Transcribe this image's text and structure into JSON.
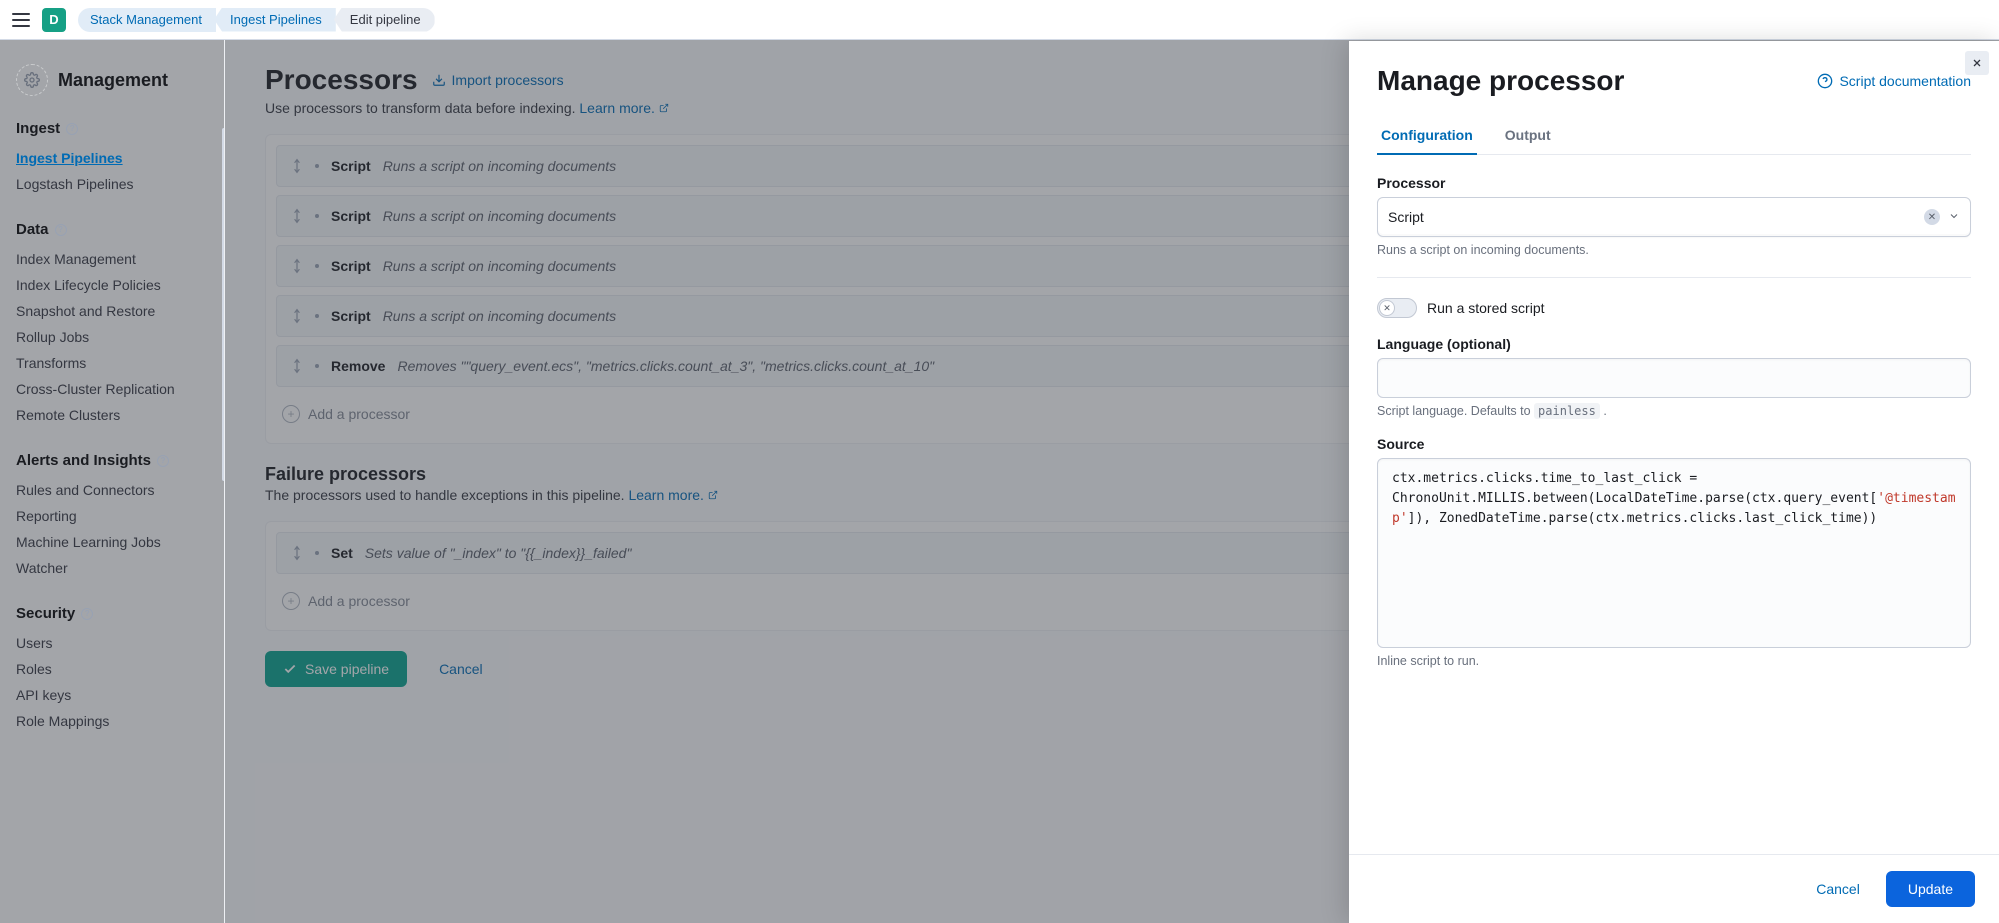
{
  "topbar": {
    "avatar_initial": "D",
    "breadcrumbs": [
      {
        "label": "Stack Management",
        "link": true
      },
      {
        "label": "Ingest Pipelines",
        "link": true
      },
      {
        "label": "Edit pipeline",
        "link": false
      }
    ]
  },
  "sidebar": {
    "title": "Management",
    "sections": [
      {
        "title": "Ingest",
        "help": true,
        "items": [
          {
            "label": "Ingest Pipelines",
            "active": true
          },
          {
            "label": "Logstash Pipelines"
          }
        ]
      },
      {
        "title": "Data",
        "help": true,
        "items": [
          {
            "label": "Index Management"
          },
          {
            "label": "Index Lifecycle Policies"
          },
          {
            "label": "Snapshot and Restore"
          },
          {
            "label": "Rollup Jobs"
          },
          {
            "label": "Transforms"
          },
          {
            "label": "Cross-Cluster Replication"
          },
          {
            "label": "Remote Clusters"
          }
        ]
      },
      {
        "title": "Alerts and Insights",
        "help": true,
        "items": [
          {
            "label": "Rules and Connectors"
          },
          {
            "label": "Reporting"
          },
          {
            "label": "Machine Learning Jobs"
          },
          {
            "label": "Watcher"
          }
        ]
      },
      {
        "title": "Security",
        "help": true,
        "items": [
          {
            "label": "Users"
          },
          {
            "label": "Roles"
          },
          {
            "label": "API keys"
          },
          {
            "label": "Role Mappings"
          }
        ]
      }
    ]
  },
  "main": {
    "processors_title": "Processors",
    "import_label": "Import processors",
    "subtext": "Use processors to transform data before indexing.",
    "learn_more": "Learn more.",
    "processors": [
      {
        "type": "Script",
        "desc": "Runs a script on incoming documents"
      },
      {
        "type": "Script",
        "desc": "Runs a script on incoming documents"
      },
      {
        "type": "Script",
        "desc": "Runs a script on incoming documents"
      },
      {
        "type": "Script",
        "desc": "Runs a script on incoming documents"
      },
      {
        "type": "Remove",
        "desc": "Removes \"\"query_event.ecs\", \"metrics.clicks.count_at_3\", \"metrics.clicks.count_at_10\""
      }
    ],
    "add_processor": "Add a processor",
    "failure_title": "Failure processors",
    "failure_subtext": "The processors used to handle exceptions in this pipeline.",
    "failure_processors": [
      {
        "type": "Set",
        "desc": "Sets value of \"_index\" to \"{{_index}}_failed\""
      }
    ],
    "save_label": "Save pipeline",
    "cancel_label": "Cancel"
  },
  "flyout": {
    "title": "Manage processor",
    "doc_link": "Script documentation",
    "tabs": {
      "config": "Configuration",
      "output": "Output"
    },
    "processor_label": "Processor",
    "processor_value": "Script",
    "processor_help": "Runs a script on incoming documents.",
    "stored_toggle": "Run a stored script",
    "language_label": "Language (optional)",
    "language_value": "",
    "language_help_pre": "Script language. Defaults to ",
    "language_help_code": "painless",
    "language_help_post": " .",
    "source_label": "Source",
    "source_code_pre": "ctx.metrics.clicks.time_to_last_click = ChronoUnit.MILLIS.between(LocalDateTime.parse(ctx.query_event[",
    "source_code_str": "'@timestamp'",
    "source_code_post": "]), ZonedDateTime.parse(ctx.metrics.clicks.last_click_time))",
    "source_help": "Inline script to run.",
    "cancel": "Cancel",
    "update": "Update"
  }
}
